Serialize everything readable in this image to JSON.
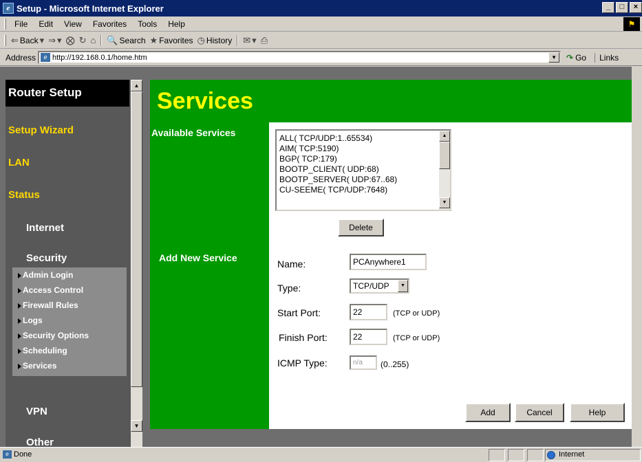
{
  "window": {
    "title": "Setup - Microsoft Internet Explorer",
    "controls": [
      "_",
      "□",
      "×"
    ]
  },
  "menu": [
    "File",
    "Edit",
    "View",
    "Favorites",
    "Tools",
    "Help"
  ],
  "toolbar": {
    "back": "Back",
    "search": "Search",
    "favorites": "Favorites",
    "history": "History"
  },
  "address": {
    "label": "Address",
    "url": "http://192.168.0.1/home.htm",
    "go": "Go",
    "links": "Links"
  },
  "nav": {
    "title": "Router Setup",
    "items": {
      "setup_wizard": "Setup Wizard",
      "lan": "LAN",
      "status": "Status",
      "internet": "Internet",
      "security": "Security",
      "vpn": "VPN",
      "other": "Other"
    },
    "security_sub": [
      "Admin Login",
      "Access Control",
      "Firewall Rules",
      "Logs",
      "Security Options",
      "Scheduling",
      "Services"
    ]
  },
  "main": {
    "title": "Services",
    "available_label": "Available Services",
    "services": [
      "ALL( TCP/UDP:1..65534)",
      "AIM( TCP:5190)",
      "BGP( TCP:179)",
      "BOOTP_CLIENT( UDP:68)",
      "BOOTP_SERVER( UDP:67..68)",
      "CU-SEEME( TCP/UDP:7648)"
    ],
    "delete_button": "Delete",
    "add_new_label": "Add New Service",
    "form": {
      "name_label": "Name:",
      "name_value": "PCAnywhere1",
      "type_label": "Type:",
      "type_value": "TCP/UDP",
      "start_port_label": "Start Port:",
      "start_port_value": "22",
      "finish_port_label": "Finish Port:",
      "finish_port_value": "22",
      "port_hint": "(TCP or UDP)",
      "icmp_label": "ICMP Type:",
      "icmp_value": "n/a",
      "icmp_hint": "(0..255)"
    },
    "buttons": {
      "add": "Add",
      "cancel": "Cancel",
      "help": "Help"
    }
  },
  "status": {
    "text": "Done",
    "zone": "Internet"
  },
  "colors": {
    "title_bar": "#0a246a",
    "nav_bg": "#585858",
    "nav_accent": "#ffd700",
    "main_bg": "#009900",
    "page_title": "#ffff00"
  }
}
